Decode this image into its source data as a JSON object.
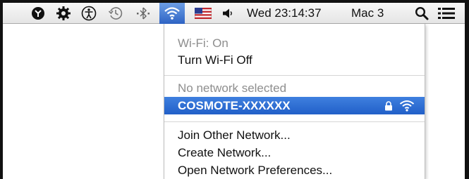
{
  "menubar": {
    "items": [
      {
        "icon": "status-icon"
      },
      {
        "icon": "gear-icon"
      },
      {
        "icon": "accessibility-icon"
      },
      {
        "icon": "time-machine-icon"
      },
      {
        "icon": "bluetooth-icon"
      },
      {
        "icon": "wifi-icon"
      },
      {
        "icon": "us-flag-icon"
      },
      {
        "icon": "volume-icon"
      }
    ],
    "clock": "Wed 23:14:37",
    "user": "Mac 3",
    "icons_right": [
      "spotlight-icon",
      "notification-list-icon"
    ]
  },
  "wifi_menu": {
    "status": "Wi-Fi: On",
    "toggle": "Turn Wi-Fi Off",
    "no_network": "No network selected",
    "networks": [
      {
        "name": "COSMOTE-XXXXXX",
        "secured": true,
        "selected": true
      }
    ],
    "join_other": "Join Other Network...",
    "create": "Create Network...",
    "preferences": "Open Network Preferences..."
  },
  "colors": {
    "highlight": "#2f6fd4",
    "menubar": "#ececec",
    "disabled_text": "#8e8e8e"
  }
}
